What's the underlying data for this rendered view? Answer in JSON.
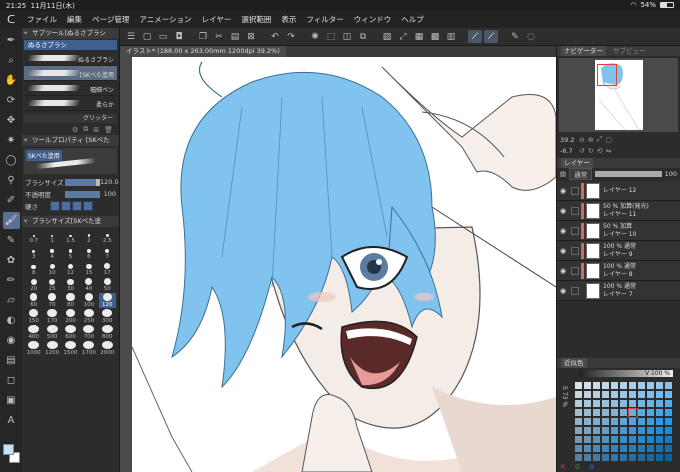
{
  "status": {
    "time": "21:25",
    "date": "11月11日(木)",
    "battery": "54%",
    "battery_level": 0.54
  },
  "menu": [
    "ファイル",
    "編集",
    "ページ管理",
    "アニメーション",
    "レイヤー",
    "選択範囲",
    "表示",
    "フィルター",
    "ウィンドウ",
    "ヘルプ"
  ],
  "document": {
    "tab": "イラスト* (188.00 x 263.00mm 1200dpi 39.2%)"
  },
  "subtool": {
    "header": "サブツール[ぬるさブラシ",
    "tab": "ぬるさブラシ",
    "brushes": [
      {
        "label": "ぬるさブラシ",
        "selected": false
      },
      {
        "label": "[SKベた塗用",
        "selected": true
      },
      {
        "label": "幅細ペン",
        "selected": false
      },
      {
        "label": "柔らか",
        "selected": false
      }
    ],
    "group": "グリッター"
  },
  "toolprop": {
    "header": "ツールプロパティ [SKベた",
    "selected_label": "SKベた塗用",
    "brush_size_label": "ブラシサイズ",
    "brush_size_value": "120.0",
    "brush_size_fraction": 0.88,
    "opacity_label": "不透明度",
    "opacity_value": "100",
    "opacity_fraction": 1.0,
    "hardness_label": "硬さ",
    "hardness_level": 4
  },
  "brushsize": {
    "header": "ブラシサイズ[SKベた塗",
    "sizes": [
      "0.7",
      "1",
      "1.5",
      "2",
      "2.5",
      "3",
      "4",
      "5",
      "6",
      "7",
      "8",
      "10",
      "12",
      "15",
      "17",
      "20",
      "25",
      "30",
      "40",
      "50",
      "60",
      "70",
      "80",
      "100",
      "120",
      "150",
      "170",
      "200",
      "250",
      "300",
      "400",
      "500",
      "600",
      "700",
      "800",
      "1000",
      "1200",
      "1500",
      "1700",
      "2000"
    ],
    "selected": "120"
  },
  "navigator": {
    "tab_active": "ナビゲーター",
    "tab_inactive": "サブビュー",
    "zoom": "39.2",
    "rotation": "-6.7"
  },
  "layers": {
    "tab": "レイヤー",
    "blend_mode": "通常",
    "opacity": "100",
    "items": [
      {
        "line1": "",
        "line2": "レイヤー 12",
        "clipped": true
      },
      {
        "line1": "50 % 加算(発光)",
        "line2": "レイヤー 11",
        "clipped": true
      },
      {
        "line1": "50 % 加算",
        "line2": "レイヤー 10",
        "clipped": true
      },
      {
        "line1": "100 % 通常",
        "line2": "レイヤー 9",
        "clipped": true
      },
      {
        "line1": "100 % 通常",
        "line2": "レイヤー 8",
        "clipped": true
      },
      {
        "line1": "100 % 通常",
        "line2": "レイヤー 7",
        "clipped": false
      }
    ]
  },
  "color": {
    "tab": "近似色",
    "v_label": "V 100 %",
    "s_label": "S 73 %",
    "r": "R",
    "g": "G",
    "b": "B",
    "accent": "#7ab8e8"
  }
}
